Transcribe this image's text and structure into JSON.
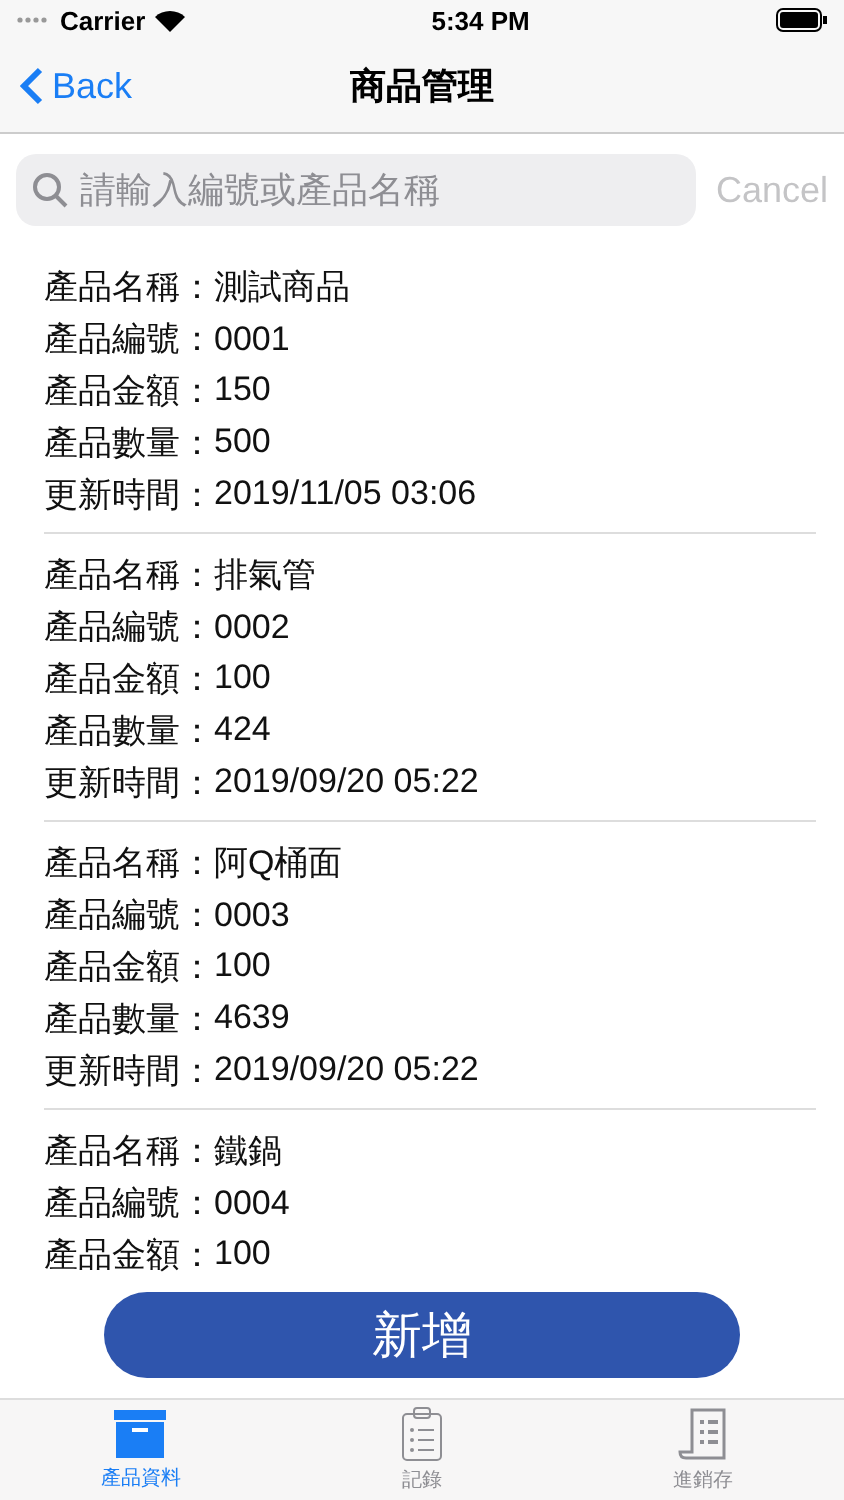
{
  "status_bar": {
    "carrier": "Carrier",
    "time": "5:34 PM"
  },
  "nav": {
    "back": "Back",
    "title": "商品管理"
  },
  "search": {
    "placeholder": "請輸入編號或產品名稱",
    "cancel": "Cancel"
  },
  "products": [
    {
      "fields": [
        {
          "label": "產品名稱：",
          "value": "測試商品"
        },
        {
          "label": "產品編號：",
          "value": "0001"
        },
        {
          "label": "產品金額：",
          "value": "150"
        },
        {
          "label": "產品數量：",
          "value": "500"
        },
        {
          "label": "更新時間：",
          "value": "2019/11/05 03:06"
        }
      ]
    },
    {
      "fields": [
        {
          "label": "產品名稱：",
          "value": "排氣管"
        },
        {
          "label": "產品編號：",
          "value": "0002"
        },
        {
          "label": "產品金額：",
          "value": "100"
        },
        {
          "label": "產品數量：",
          "value": "424"
        },
        {
          "label": "更新時間：",
          "value": "2019/09/20 05:22"
        }
      ]
    },
    {
      "fields": [
        {
          "label": "產品名稱：",
          "value": "阿Q桶面"
        },
        {
          "label": "產品編號：",
          "value": "0003"
        },
        {
          "label": "產品金額：",
          "value": "100"
        },
        {
          "label": "產品數量：",
          "value": "4639"
        },
        {
          "label": "更新時間：",
          "value": "2019/09/20 05:22"
        }
      ]
    },
    {
      "fields": [
        {
          "label": "產品名稱：",
          "value": "鐵鍋"
        },
        {
          "label": "產品編號：",
          "value": "0004"
        },
        {
          "label": "產品金額：",
          "value": "100"
        }
      ]
    }
  ],
  "add_button": "新增",
  "tabs": [
    {
      "label": "產品資料",
      "selected": true
    },
    {
      "label": "記錄",
      "selected": false
    },
    {
      "label": "進銷存",
      "selected": false
    }
  ]
}
